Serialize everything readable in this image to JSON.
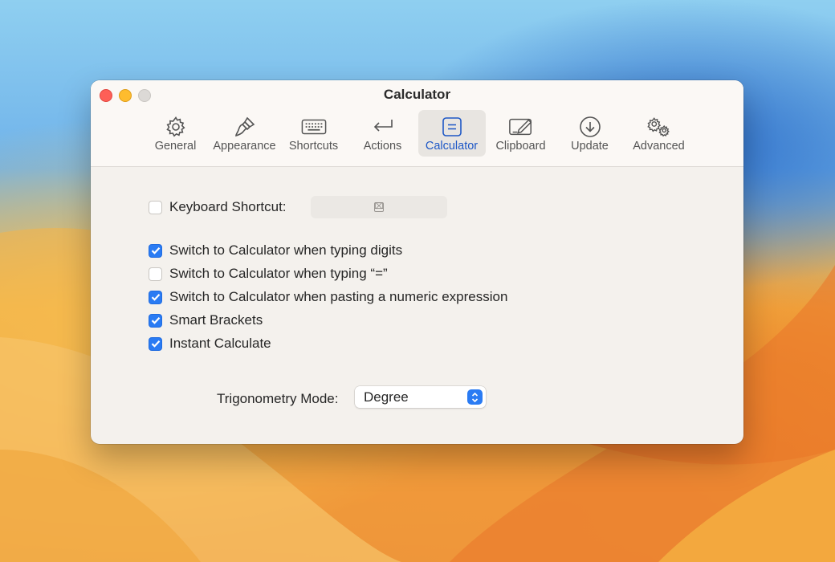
{
  "window": {
    "title": "Calculator"
  },
  "toolbar": {
    "tabs": [
      {
        "label": "General",
        "icon": "gear-icon"
      },
      {
        "label": "Appearance",
        "icon": "paintbrush-icon"
      },
      {
        "label": "Shortcuts",
        "icon": "keyboard-icon"
      },
      {
        "label": "Actions",
        "icon": "return-arrow-icon"
      },
      {
        "label": "Calculator",
        "icon": "calculator-icon",
        "selected": true
      },
      {
        "label": "Clipboard",
        "icon": "clipboard-icon"
      },
      {
        "label": "Update",
        "icon": "download-circle-icon"
      },
      {
        "label": "Advanced",
        "icon": "gears-icon"
      }
    ]
  },
  "settings": {
    "keyboard_shortcut": {
      "label": "Keyboard Shortcut:",
      "checked": false,
      "clear_glyph": "⌧"
    },
    "options": [
      {
        "label": "Switch to Calculator when typing digits",
        "checked": true
      },
      {
        "label": "Switch to Calculator when typing “=”",
        "checked": false
      },
      {
        "label": "Switch to Calculator when pasting a numeric expression",
        "checked": true
      },
      {
        "label": "Smart Brackets",
        "checked": true
      },
      {
        "label": "Instant Calculate",
        "checked": true
      }
    ],
    "trigonometry": {
      "label": "Trigonometry Mode:",
      "value": "Degree"
    }
  },
  "colors": {
    "accent": "#2a7bf3",
    "selected_tab_text": "#1d57c6",
    "close": "#fe5f57",
    "minimize": "#febc2e",
    "zoom_disabled": "#dcd9d6"
  }
}
